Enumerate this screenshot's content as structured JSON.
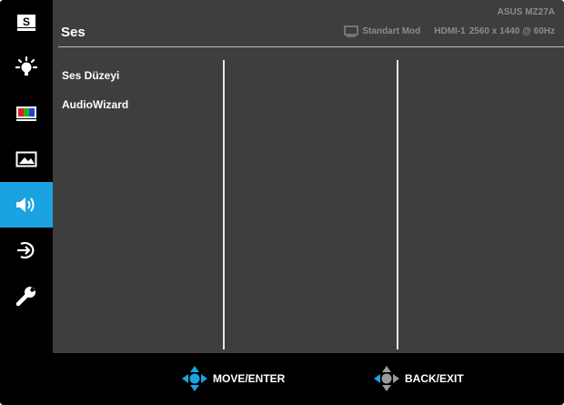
{
  "header": {
    "title": "Ses",
    "model": "ASUS MZ27A",
    "mode": "Standart Mod",
    "input": "HDMI-1",
    "resolution": "2560 x 1440 @ 60Hz"
  },
  "sidebar": {
    "active_index": 4,
    "items": [
      {
        "icon": "splendid-icon",
        "glyph": "S"
      },
      {
        "icon": "brightness-icon"
      },
      {
        "icon": "color-icon"
      },
      {
        "icon": "image-icon"
      },
      {
        "icon": "sound-icon"
      },
      {
        "icon": "input-select-icon"
      },
      {
        "icon": "system-setup-icon"
      }
    ]
  },
  "menu": {
    "items": [
      {
        "label": "Ses Düzeyi"
      },
      {
        "label": "AudioWizard"
      }
    ]
  },
  "footer": {
    "move_label": "MOVE/ENTER",
    "back_label": "BACK/EXIT",
    "accent": "#1aa3e0"
  }
}
